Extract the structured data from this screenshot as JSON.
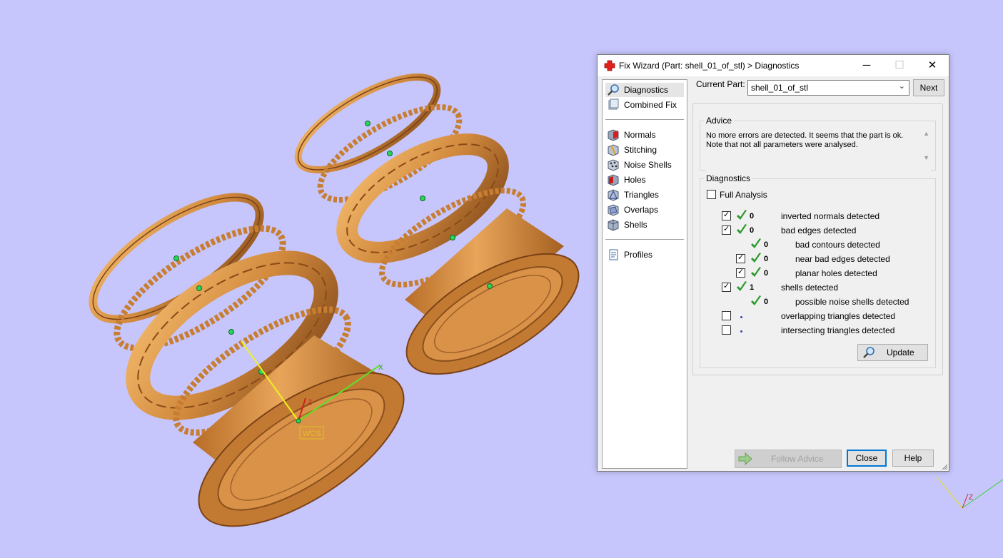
{
  "window": {
    "title": "Fix Wizard (Part: shell_01_of_stl) > Diagnostics",
    "minimize": "─",
    "maximize": "☐",
    "close": "✕"
  },
  "nav": {
    "top": [
      {
        "label": "Diagnostics",
        "icon": "magnifier-icon",
        "selected": true
      },
      {
        "label": "Combined Fix",
        "icon": "combined-fix-icon"
      }
    ],
    "fixes": [
      {
        "label": "Normals",
        "icon": "normals-icon"
      },
      {
        "label": "Stitching",
        "icon": "stitching-icon"
      },
      {
        "label": "Noise Shells",
        "icon": "noise-shells-icon"
      },
      {
        "label": "Holes",
        "icon": "holes-icon"
      },
      {
        "label": "Triangles",
        "icon": "triangles-icon"
      },
      {
        "label": "Overlaps",
        "icon": "overlaps-icon"
      },
      {
        "label": "Shells",
        "icon": "shells-icon"
      }
    ],
    "bottom": [
      {
        "label": "Profiles",
        "icon": "profiles-icon"
      }
    ]
  },
  "current_part": {
    "label": "Current Part:",
    "value": "shell_01_of_stl",
    "next_label": "Next"
  },
  "advice": {
    "title": "Advice",
    "line1": "No more errors are detected. It seems that the part is ok.",
    "line2": "Note that not all parameters were analysed."
  },
  "diagnostics": {
    "title": "Diagnostics",
    "full_analysis_label": "Full Analysis",
    "full_analysis_checked": false,
    "rows": [
      {
        "checked": true,
        "status": "ok",
        "value": "0",
        "label": "inverted normals detected",
        "indent": 0
      },
      {
        "checked": true,
        "status": "ok",
        "value": "0",
        "label": "bad edges detected",
        "indent": 0
      },
      {
        "checked": null,
        "status": "ok",
        "value": "0",
        "label": "bad contours detected",
        "indent": 1
      },
      {
        "checked": true,
        "status": "ok",
        "value": "0",
        "label": "near bad edges detected",
        "indent": 1
      },
      {
        "checked": true,
        "status": "ok",
        "value": "0",
        "label": "planar holes detected",
        "indent": 1
      },
      {
        "checked": true,
        "status": "ok",
        "value": "1",
        "label": "shells detected",
        "indent": 0
      },
      {
        "checked": null,
        "status": "ok",
        "value": "0",
        "label": "possible noise shells detected",
        "indent": 1
      },
      {
        "checked": false,
        "status": "dot",
        "value": "",
        "label": "overlapping triangles detected",
        "indent": 0
      },
      {
        "checked": false,
        "status": "dot",
        "value": "",
        "label": "intersecting triangles detected",
        "indent": 0
      }
    ],
    "update_label": "Update"
  },
  "footer": {
    "follow_advice_label": "Follow Advice",
    "close_label": "Close",
    "help_label": "Help"
  },
  "viewport": {
    "wcs_label": "WCS",
    "axis_x": "X",
    "axis_z": "Z",
    "mini_axis_z": "Z"
  },
  "colors": {
    "background": "#c7c6fc",
    "ring": "#d28a3e",
    "ok_check": "#2e9a2e",
    "accent": "#0078d7"
  }
}
